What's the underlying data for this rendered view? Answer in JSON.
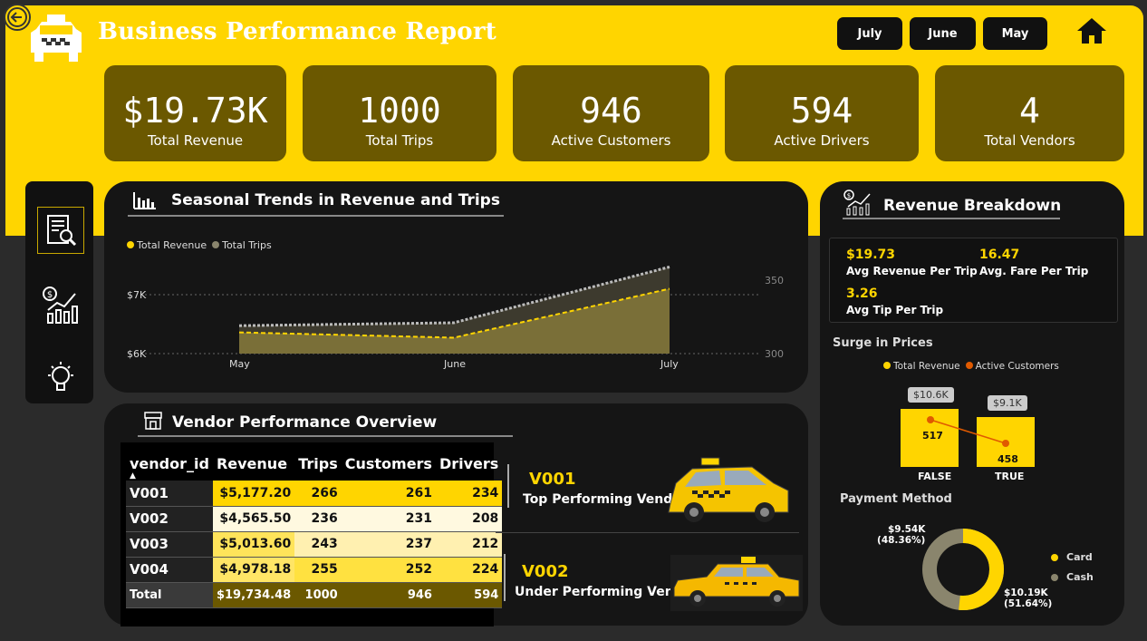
{
  "header": {
    "title": "Business Performance Report",
    "months": [
      "July",
      "June",
      "May"
    ]
  },
  "kpis": [
    {
      "value": "$19.73K",
      "label": "Total Revenue"
    },
    {
      "value": "1000",
      "label": "Total Trips"
    },
    {
      "value": "946",
      "label": "Active Customers"
    },
    {
      "value": "594",
      "label": "Active Drivers"
    },
    {
      "value": "4",
      "label": "Total Vendors"
    }
  ],
  "sidenav": {
    "icons": [
      "report-search-icon",
      "revenue-growth-icon",
      "lightbulb-icon"
    ]
  },
  "seasonal": {
    "title": "Seasonal Trends in Revenue and Trips",
    "legend": [
      "Total Revenue",
      "Total Trips"
    ],
    "y_left_ticks": [
      "$7K",
      "$6K"
    ],
    "y_right_ticks": [
      "350",
      "300"
    ],
    "x_ticks": [
      "May",
      "June",
      "July"
    ]
  },
  "chart_data": {
    "type": "area",
    "title": "Seasonal Trends in Revenue and Trips",
    "categories": [
      "May",
      "June",
      "July"
    ],
    "series": [
      {
        "name": "Total Revenue",
        "axis": "left",
        "values": [
          6360,
          6270,
          7100
        ],
        "color": "#ffd500"
      },
      {
        "name": "Total Trips",
        "axis": "right",
        "values": [
          319,
          321,
          359
        ],
        "color": "#8a856d"
      }
    ],
    "ylim_left": [
      6000,
      7000
    ],
    "ylim_right": [
      300,
      350
    ],
    "legend_placement": "top-left",
    "grid": true
  },
  "vendor": {
    "title": "Vendor Performance Overview",
    "columns": [
      "vendor_id",
      "Revenue",
      "Trips",
      "Customers",
      "Drivers"
    ],
    "rows": [
      {
        "id": "V001",
        "revenue": "$5,177.20",
        "trips": "266",
        "customers": "261",
        "drivers": "234"
      },
      {
        "id": "V002",
        "revenue": "$4,565.50",
        "trips": "236",
        "customers": "231",
        "drivers": "208"
      },
      {
        "id": "V003",
        "revenue": "$5,013.60",
        "trips": "243",
        "customers": "237",
        "drivers": "212"
      },
      {
        "id": "V004",
        "revenue": "$4,978.18",
        "trips": "255",
        "customers": "252",
        "drivers": "224"
      }
    ],
    "total": {
      "id": "Total",
      "revenue": "$19,734.48",
      "trips": "1000",
      "customers": "946",
      "drivers": "594"
    },
    "top": {
      "id": "V001",
      "label": "Top Performing Vendor"
    },
    "under": {
      "id": "V002",
      "label": "Under Performing Vendor"
    }
  },
  "breakdown": {
    "title": "Revenue Breakdown",
    "avg_revenue": {
      "value": "$19.73",
      "label": "Avg Revenue Per Trip"
    },
    "avg_fare": {
      "value": "16.47",
      "label": "Avg. Fare Per Trip"
    },
    "avg_tip": {
      "value": "3.26",
      "label": "Avg Tip Per Trip"
    },
    "surge": {
      "title": "Surge in Prices",
      "legend": [
        "Total Revenue",
        "Active Customers"
      ],
      "categories": [
        "FALSE",
        "TRUE"
      ],
      "revenue_labels": [
        "$10.6K",
        "$9.1K"
      ],
      "customer_values": [
        "517",
        "458"
      ]
    },
    "payment": {
      "title": "Payment Method",
      "legend": [
        "Card",
        "Cash"
      ],
      "cash_label": "$9.54K",
      "cash_pct": "(48.36%)",
      "card_label": "$10.19K",
      "card_pct": "(51.64%)"
    }
  }
}
